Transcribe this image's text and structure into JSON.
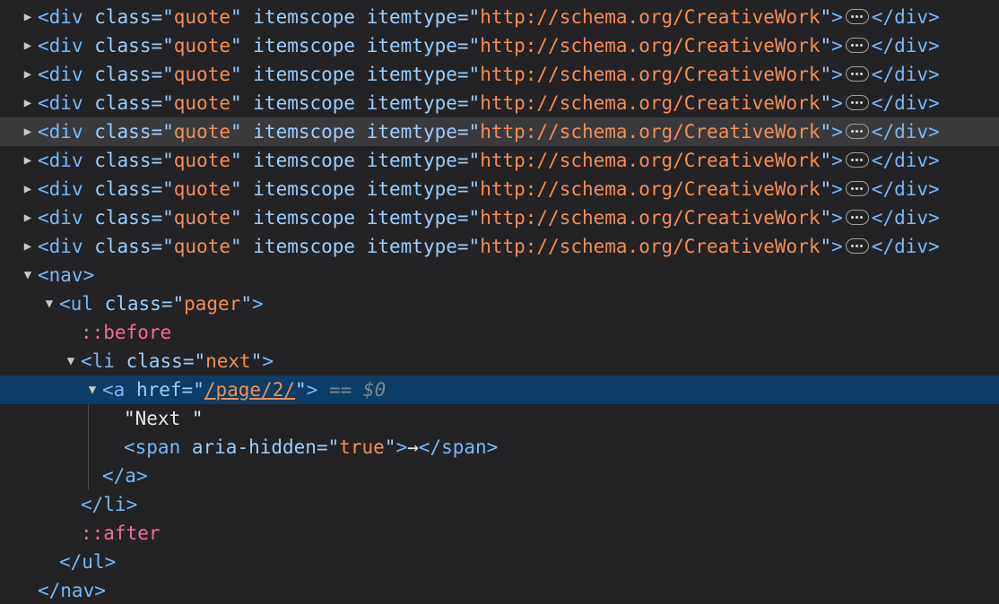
{
  "quote_rows": [
    {
      "tag": "div",
      "attr1": "class",
      "val1": "quote",
      "attr2": "itemscope",
      "attr3": "itemtype",
      "val3": "http://schema.org/CreativeWork",
      "close": "</div>"
    },
    {
      "tag": "div",
      "attr1": "class",
      "val1": "quote",
      "attr2": "itemscope",
      "attr3": "itemtype",
      "val3": "http://schema.org/CreativeWork",
      "close": "</div>"
    },
    {
      "tag": "div",
      "attr1": "class",
      "val1": "quote",
      "attr2": "itemscope",
      "attr3": "itemtype",
      "val3": "http://schema.org/CreativeWork",
      "close": "</div>"
    },
    {
      "tag": "div",
      "attr1": "class",
      "val1": "quote",
      "attr2": "itemscope",
      "attr3": "itemtype",
      "val3": "http://schema.org/CreativeWork",
      "close": "</div>"
    },
    {
      "tag": "div",
      "attr1": "class",
      "val1": "quote",
      "attr2": "itemscope",
      "attr3": "itemtype",
      "val3": "http://schema.org/CreativeWork",
      "close": "</div>"
    },
    {
      "tag": "div",
      "attr1": "class",
      "val1": "quote",
      "attr2": "itemscope",
      "attr3": "itemtype",
      "val3": "http://schema.org/CreativeWork",
      "close": "</div>"
    },
    {
      "tag": "div",
      "attr1": "class",
      "val1": "quote",
      "attr2": "itemscope",
      "attr3": "itemtype",
      "val3": "http://schema.org/CreativeWork",
      "close": "</div>"
    },
    {
      "tag": "div",
      "attr1": "class",
      "val1": "quote",
      "attr2": "itemscope",
      "attr3": "itemtype",
      "val3": "http://schema.org/CreativeWork",
      "close": "</div>"
    },
    {
      "tag": "div",
      "attr1": "class",
      "val1": "quote",
      "attr2": "itemscope",
      "attr3": "itemtype",
      "val3": "http://schema.org/CreativeWork",
      "close": "</div>"
    }
  ],
  "hovered_row_index": 4,
  "nav": {
    "open": "<nav>",
    "close": "</nav>"
  },
  "ul": {
    "tag": "ul",
    "attr": "class",
    "val": "pager",
    "close": "</ul>"
  },
  "before": "::before",
  "after": "::after",
  "li": {
    "tag": "li",
    "attr": "class",
    "val": "next",
    "close": "</li>"
  },
  "a": {
    "tag": "a",
    "attr": "href",
    "val": "/page/2/",
    "eq": "==",
    "ref": "$0",
    "close": "</a>"
  },
  "text_node": "\"Next \"",
  "span": {
    "open": "<span",
    "attr": "aria-hidden",
    "val": "true",
    "content": "→",
    "close": "</span>"
  },
  "colors": {
    "background": "#232325",
    "tag": "#7ab7f5",
    "attribute_value": "#f58d55",
    "pseudo_element": "#f36b9c",
    "selection": "#0b3d66",
    "hover": "#3a3a3c"
  }
}
